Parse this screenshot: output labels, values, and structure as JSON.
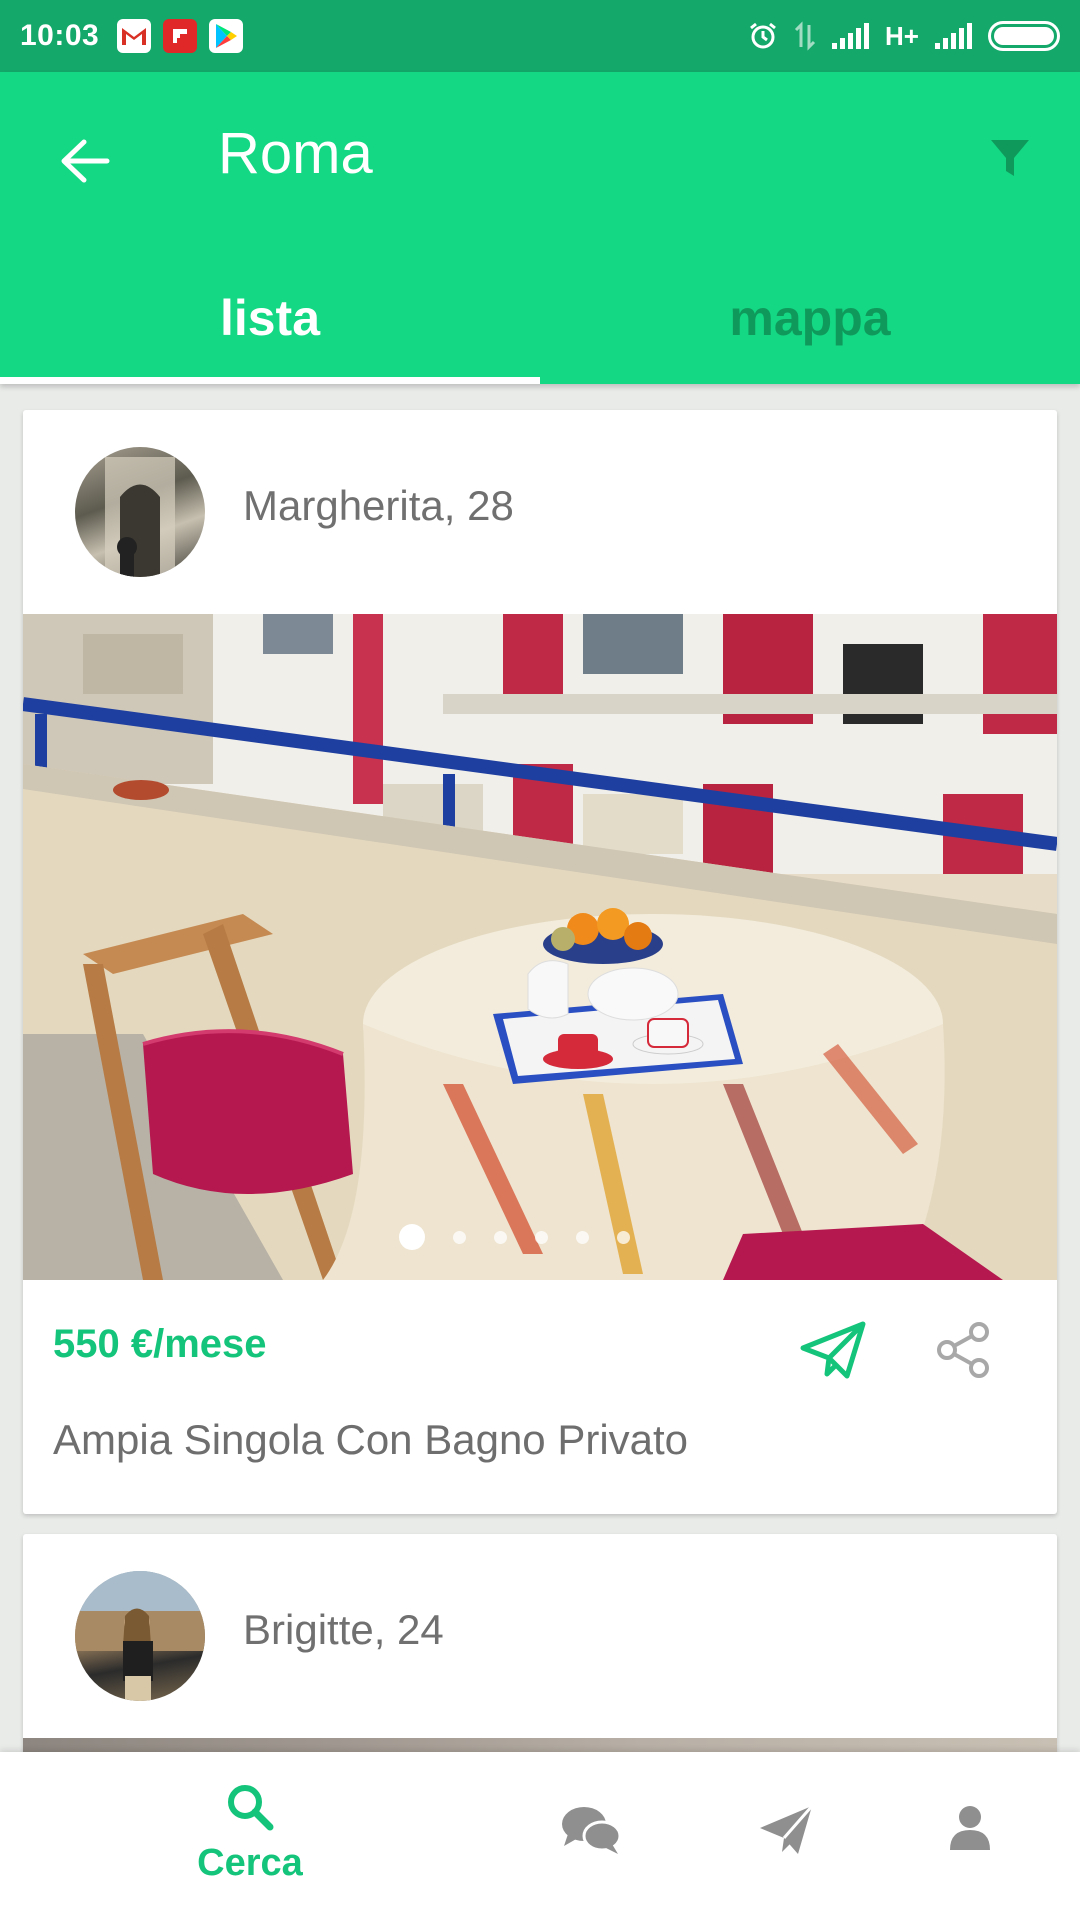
{
  "status_bar": {
    "time": "10:03",
    "network_label": "H+",
    "notifications": [
      "gmail-icon",
      "flipboard-icon",
      "play-store-icon"
    ]
  },
  "app_bar": {
    "title": "Roma",
    "tabs": [
      {
        "label": "lista",
        "active": true
      },
      {
        "label": "mappa",
        "active": false
      }
    ]
  },
  "listings": [
    {
      "host": "Margherita, 28",
      "price": "550 €/mese",
      "title": "Ampia Singola Con Bagno Privato",
      "photo_count": 6,
      "photo_index": 1
    },
    {
      "host": "Brigitte, 24"
    }
  ],
  "bottom_nav": {
    "items": [
      {
        "label": "Cerca",
        "icon": "search-icon",
        "active": true
      },
      {
        "label": "",
        "icon": "chat-icon",
        "active": false
      },
      {
        "label": "",
        "icon": "send-icon",
        "active": false
      },
      {
        "label": "",
        "icon": "profile-icon",
        "active": false
      }
    ]
  },
  "colors": {
    "status_bar": "#14a86a",
    "app_bar": "#14d884",
    "accent": "#14c47a",
    "inactive_tab": "#0f9a5c",
    "text_gray": "#707070"
  }
}
